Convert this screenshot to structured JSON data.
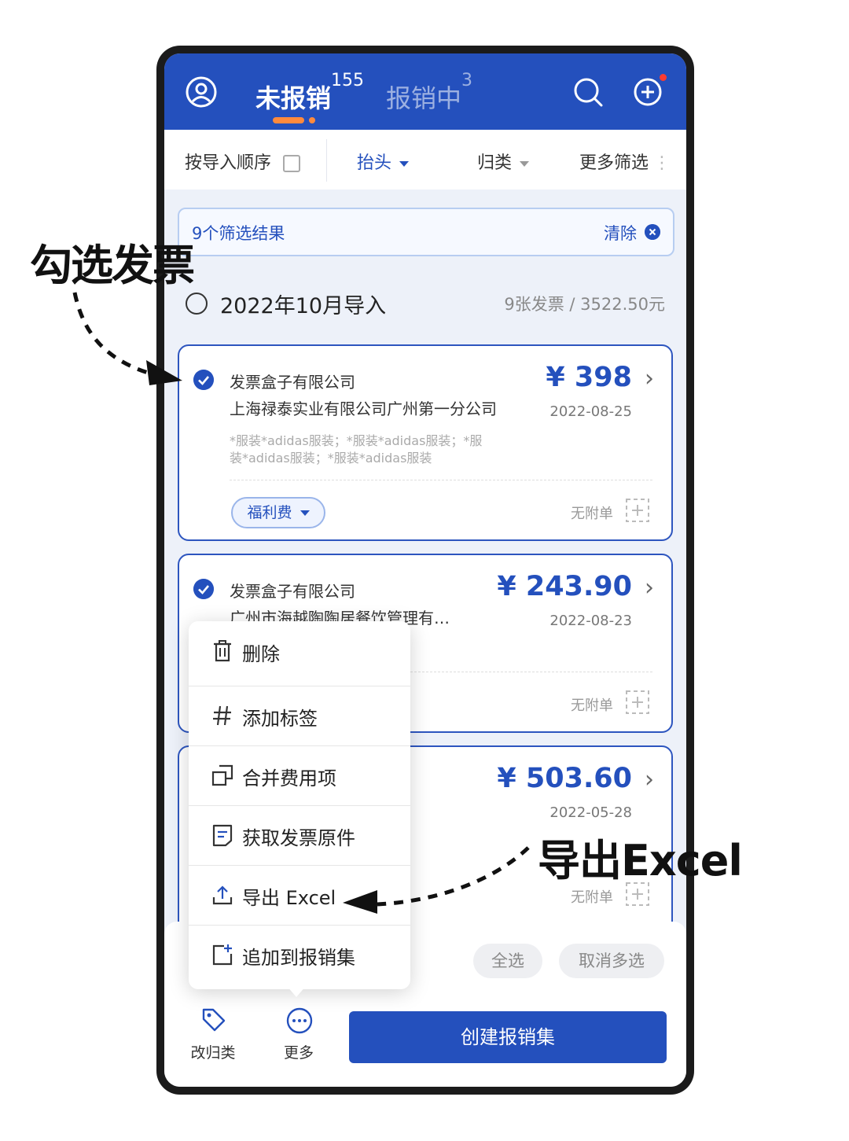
{
  "header": {
    "tab_active": "未报销",
    "tab_active_count": "155",
    "tab_inactive": "报销中",
    "tab_inactive_count": "3",
    "icons": [
      "user-icon",
      "search-icon",
      "add-circle-icon"
    ]
  },
  "filters": {
    "sort": "按导入顺序",
    "title": "抬头",
    "category": "归类",
    "more": "更多筛选"
  },
  "result_banner": {
    "text": "9个筛选结果",
    "clear": "清除"
  },
  "group": {
    "title": "2022年10月导入",
    "summary": "9张发票 / 3522.50元"
  },
  "invoices": [
    {
      "seller": "发票盒子有限公司",
      "buyer": "上海禄泰实业有限公司广州第一分公司",
      "amount": "¥ 398",
      "date": "2022-08-25",
      "items_line1": "*服装*adidas服装；*服装*adidas服装；*服",
      "items_line2": "装*adidas服装；*服装*adidas服装",
      "tag": "福利费",
      "attachment": "无附单"
    },
    {
      "seller": "发票盒子有限公司",
      "buyer": "广州市海越陶陶居餐饮管理有…",
      "amount": "¥ 243.90",
      "date": "2022-08-23",
      "attachment": "无附单"
    },
    {
      "amount": "¥ 503.60",
      "date": "2022-05-28",
      "attachment": "无附单"
    }
  ],
  "menu": {
    "items": [
      {
        "label": "删除",
        "icon": "trash-icon"
      },
      {
        "label": "添加标签",
        "icon": "hash-icon"
      },
      {
        "label": "合并费用项",
        "icon": "merge-icon"
      },
      {
        "label": "获取发票原件",
        "icon": "document-icon"
      },
      {
        "label": "导出 Excel",
        "icon": "upload-icon"
      },
      {
        "label": "追加到报销集",
        "icon": "add-to-set-icon"
      }
    ]
  },
  "bottom": {
    "select_all": "全选",
    "cancel_multi": "取消多选",
    "reclassify": "改归类",
    "more": "更多",
    "create": "创建报销集"
  },
  "annotations": {
    "check_invoice": "勾选发票",
    "export_excel": "导出Excel"
  },
  "colors": {
    "primary": "#2450bd",
    "accent": "#ff8a3d",
    "background": "#edf1f9"
  }
}
